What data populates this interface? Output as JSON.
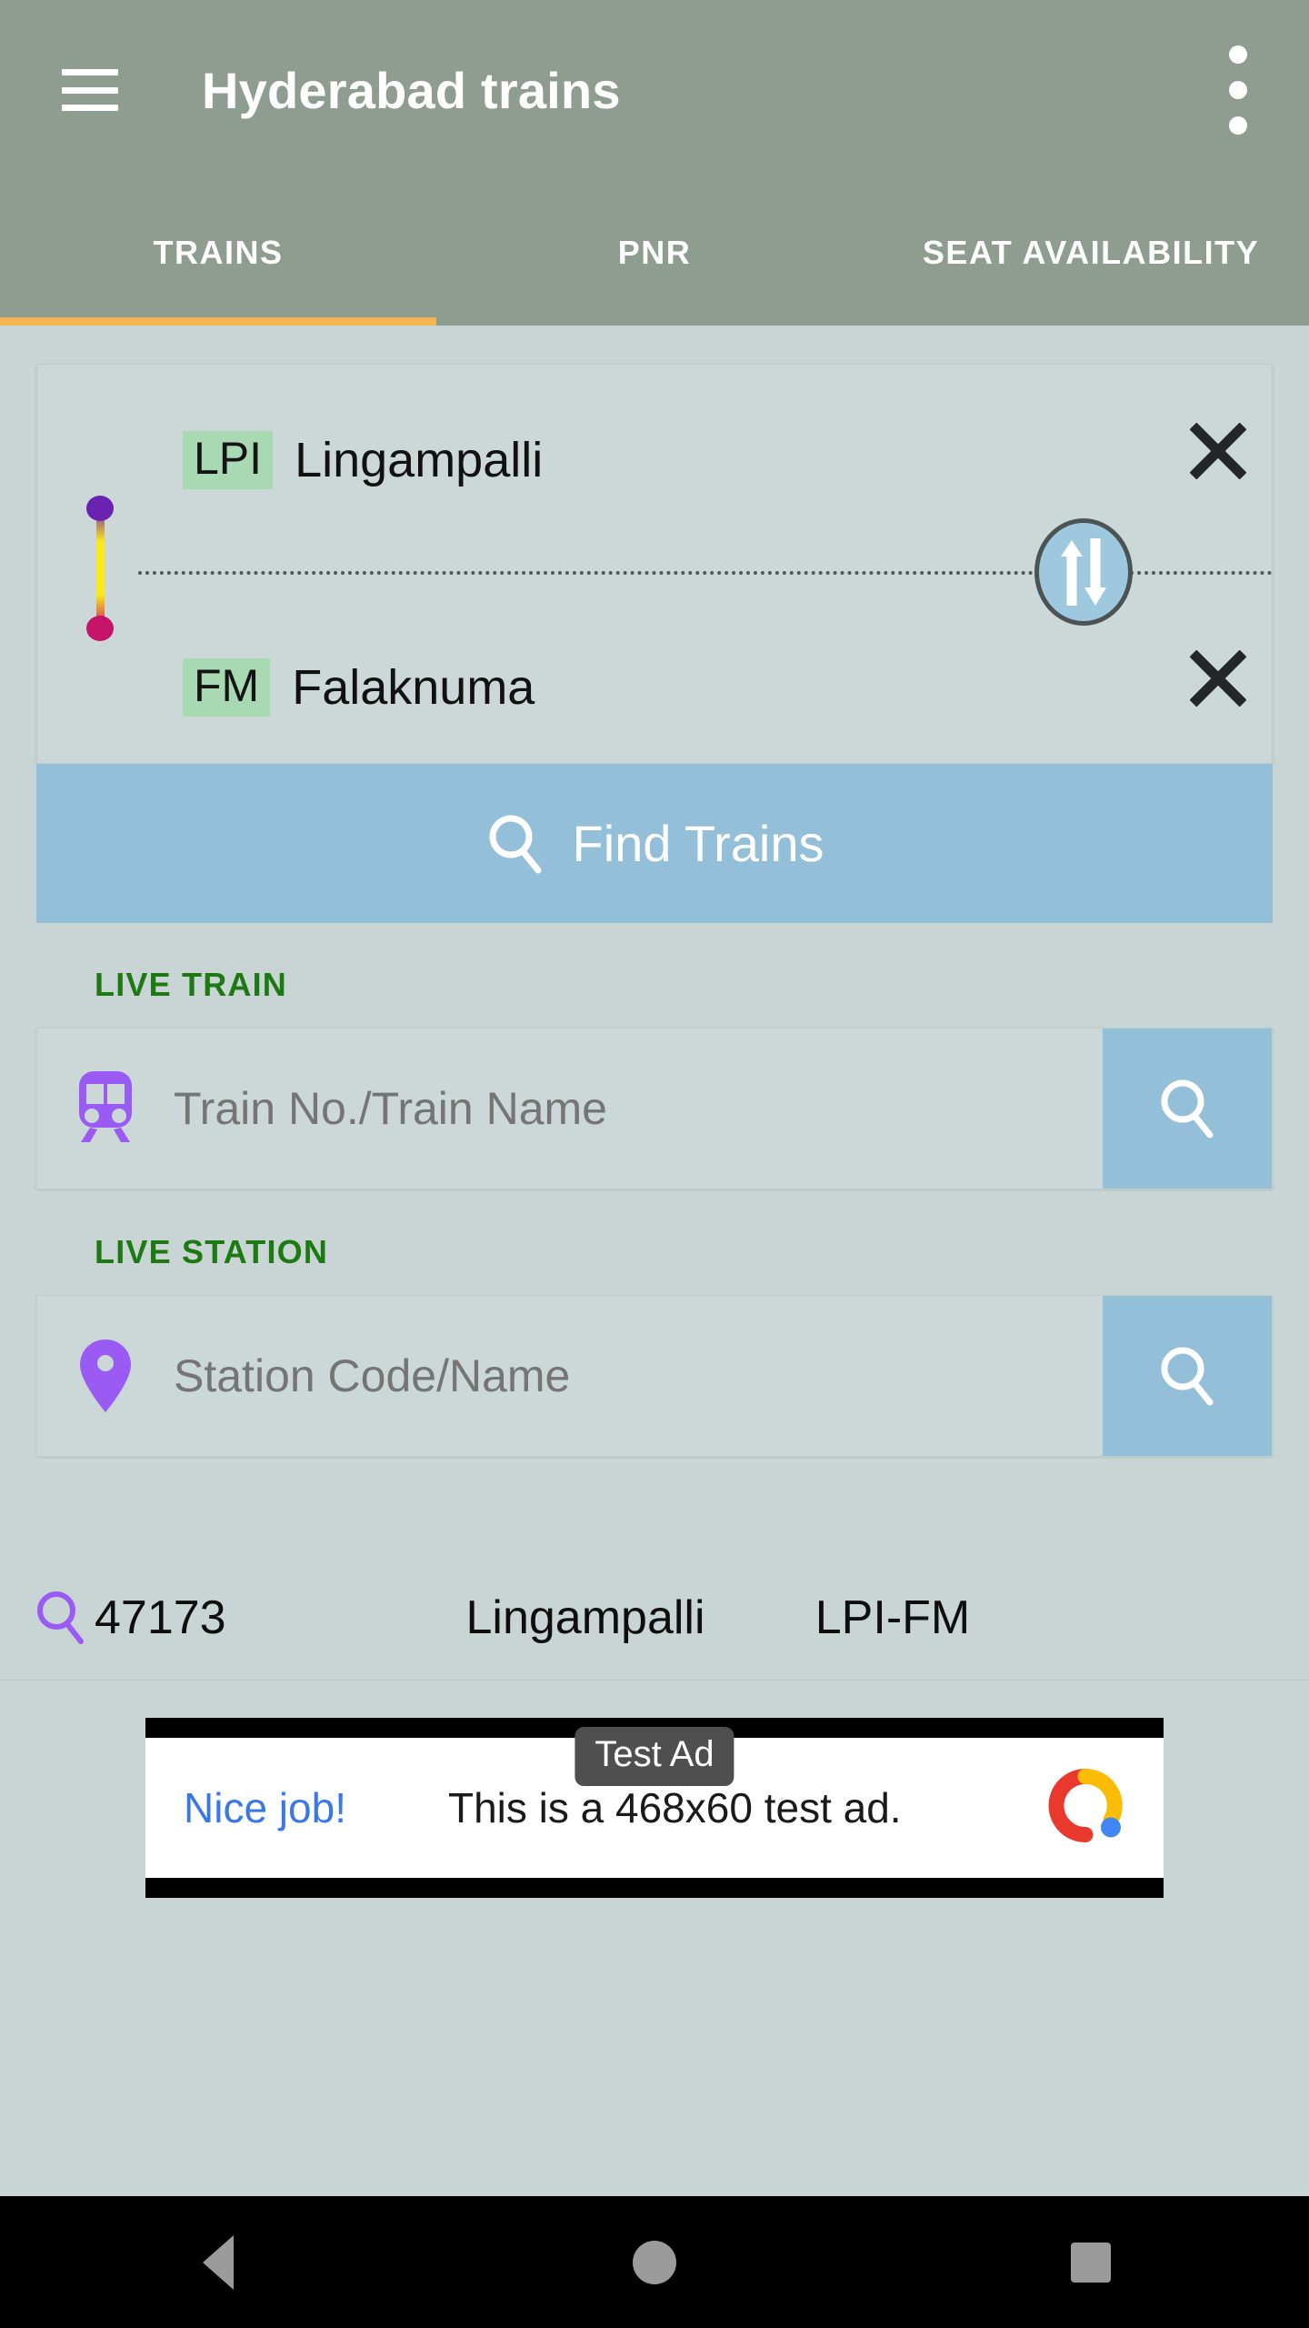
{
  "appbar": {
    "title": "Hyderabad trains",
    "menu_icon": "hamburger-menu-icon",
    "overflow_icon": "more-vertical-icon"
  },
  "tabs": [
    {
      "label": "TRAINS",
      "active": true
    },
    {
      "label": "PNR",
      "active": false
    },
    {
      "label": "SEAT AVAILABILITY",
      "active": false
    }
  ],
  "search_card": {
    "from": {
      "code": "LPI",
      "name": "Lingampalli",
      "clear_icon": "close-icon"
    },
    "to": {
      "code": "FM",
      "name": "Falaknuma",
      "clear_icon": "close-icon"
    },
    "swap_icon": "swap-vertical-icon",
    "find_trains": {
      "label": "Find Trains",
      "icon": "search-icon"
    }
  },
  "live_train": {
    "section_label": "LIVE TRAIN",
    "icon": "train-icon",
    "placeholder": "Train No./Train Name",
    "value": "",
    "search_icon": "search-icon"
  },
  "live_station": {
    "section_label": "LIVE STATION",
    "icon": "map-pin-icon",
    "placeholder": "Station Code/Name",
    "value": "",
    "search_icon": "search-icon"
  },
  "recent_search": {
    "icon": "search-icon",
    "number": "47173",
    "name": "Lingampalli",
    "route": "LPI-FM"
  },
  "ad": {
    "badge": "Test Ad",
    "cta": "Nice job!",
    "text": "This is a 468x60 test ad.",
    "logo": "admob-logo-icon"
  },
  "navbar": {
    "back": "back-triangle-icon",
    "home": "home-circle-icon",
    "recents": "recents-square-icon"
  },
  "colors": {
    "appbar_bg": "#8e9d90",
    "page_bg": "#c9d5d5",
    "accent_underline": "#f5b553",
    "primary_button": "#93c0d8",
    "code_badge": "#a9d9b2",
    "section_label": "#1d7a12",
    "icon_purple": "#9a5bf5",
    "route_start": "#6a22b0",
    "route_end": "#c6136a",
    "route_mid": "#ffe817"
  }
}
